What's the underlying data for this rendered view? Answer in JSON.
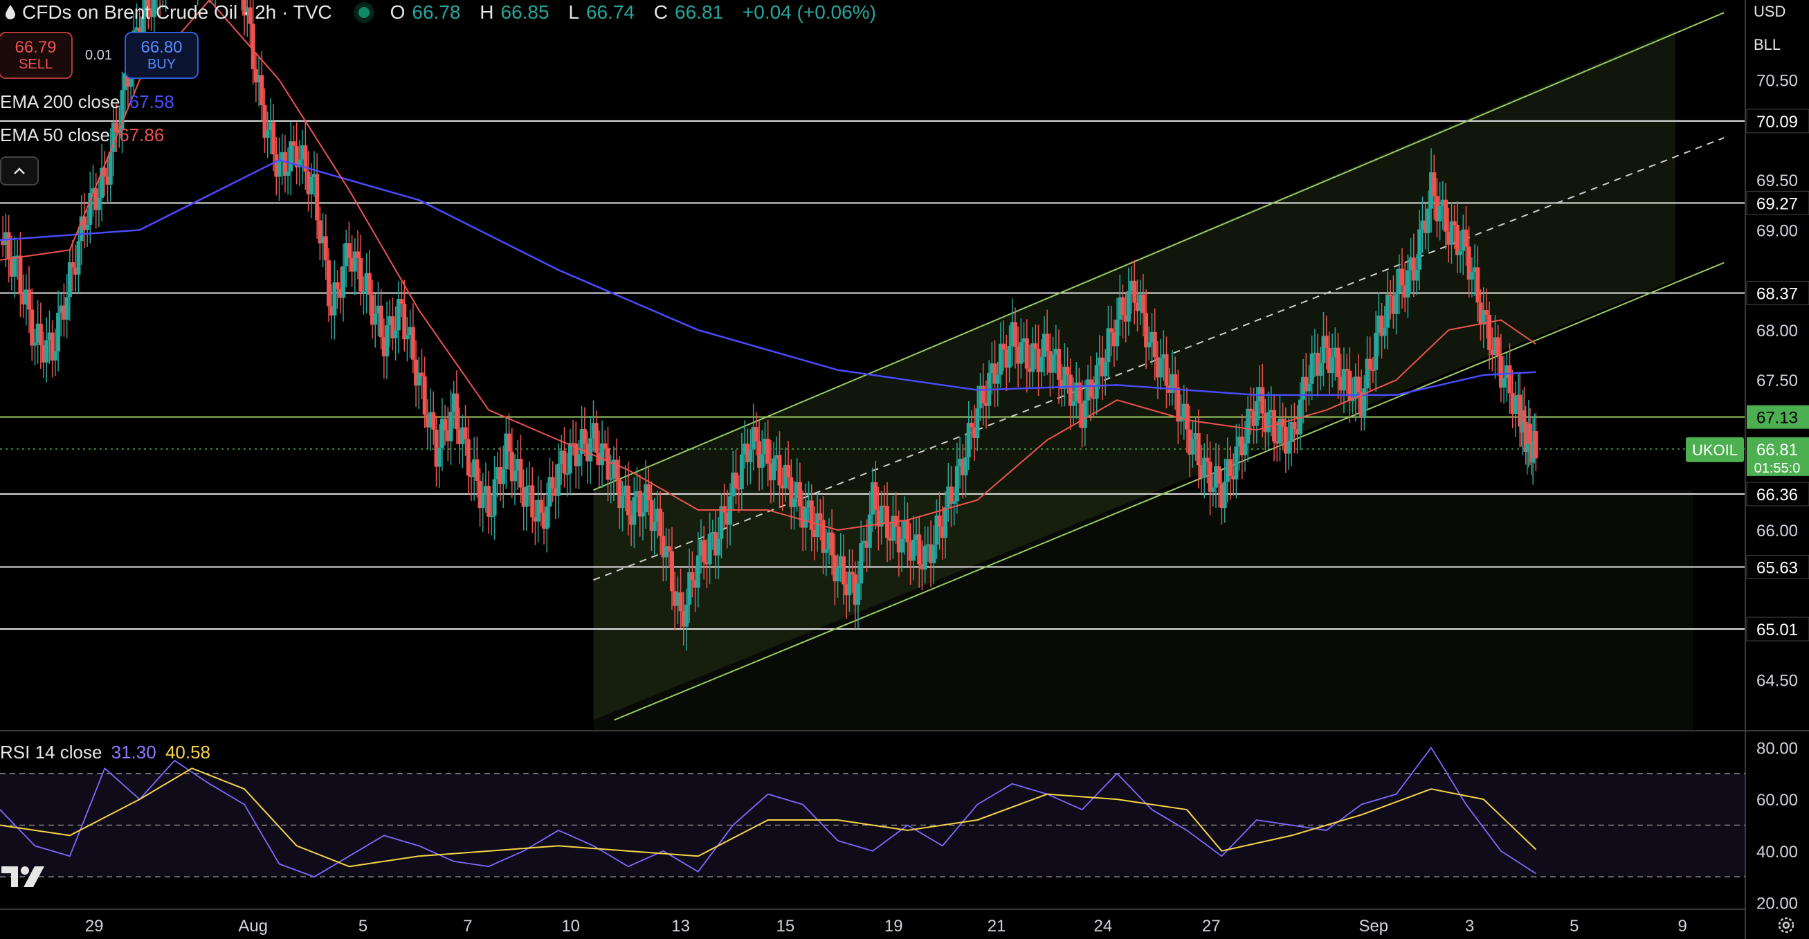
{
  "header": {
    "title": "CFDs on Brent Crude Oil · 2h · TVC",
    "ohlc": {
      "o_label": "O",
      "o": "66.78",
      "h_label": "H",
      "h": "66.85",
      "l_label": "L",
      "l": "66.74",
      "c_label": "C",
      "c": "66.81",
      "change": "+0.04 (+0.06%)"
    }
  },
  "trade": {
    "sell_price": "66.79",
    "sell_label": "SELL",
    "spread": "0.01",
    "buy_price": "66.80",
    "buy_label": "BUY"
  },
  "indicators": {
    "ema200": {
      "label": "EMA 200 close",
      "value": "67.58",
      "color": "#4b4bff"
    },
    "ema50": {
      "label": "EMA 50 close",
      "value": "67.86",
      "color": "#ef5350"
    },
    "rsi": {
      "label": "RSI 14 close",
      "value": "31.30",
      "ma_value": "40.58",
      "color": "#7e57c2",
      "ma_color": "#f5d547"
    }
  },
  "currency": {
    "top": "USD",
    "sub": "BLL"
  },
  "colors": {
    "up": "#26a69a",
    "down": "#ef5350",
    "channel": "#9ccc65",
    "accent": "#4caf50"
  },
  "chart_data": {
    "type": "line",
    "title": "CFDs on Brent Crude Oil · 2h · TVC",
    "symbol": "UKOIL",
    "last_price": "66.81",
    "countdown": "01:55:0",
    "price_ticks": [
      "70.50",
      "69.50",
      "69.00",
      "68.00",
      "67.50",
      "66.00",
      "64.50"
    ],
    "level_labels": [
      "70.09",
      "69.27",
      "68.37",
      "67.13",
      "66.36",
      "65.63",
      "65.01"
    ],
    "levels": [
      70.09,
      69.27,
      68.37,
      67.13,
      66.36,
      65.63,
      65.01
    ],
    "x_labels": [
      "29",
      "Aug",
      "5",
      "7",
      "10",
      "13",
      "15",
      "19",
      "21",
      "24",
      "27",
      "Sep",
      "3",
      "5",
      "9"
    ],
    "rsi_ticks": [
      "80.00",
      "60.00",
      "40.00",
      "20.00"
    ],
    "rsi_bands": [
      70,
      50,
      30
    ],
    "ylim": [
      64.0,
      71.3
    ],
    "rsi_ylim": [
      18,
      86
    ],
    "channel": {
      "x": [
        0.34,
        0.96
      ],
      "upper": [
        66.4,
        71.0
      ],
      "mid": [
        65.5,
        69.75
      ],
      "lower": [
        64.1,
        68.5
      ]
    },
    "close_path": [
      [
        0,
        68.9
      ],
      [
        0.01,
        68.6
      ],
      [
        0.02,
        67.9
      ],
      [
        0.03,
        67.8
      ],
      [
        0.04,
        68.5
      ],
      [
        0.05,
        69.2
      ],
      [
        0.06,
        69.5
      ],
      [
        0.07,
        70.3
      ],
      [
        0.08,
        71.1
      ],
      [
        0.09,
        71.4
      ],
      [
        0.1,
        71.8
      ],
      [
        0.12,
        71.5
      ],
      [
        0.13,
        72.0
      ],
      [
        0.14,
        71.3
      ],
      [
        0.15,
        70.2
      ],
      [
        0.16,
        69.6
      ],
      [
        0.17,
        69.8
      ],
      [
        0.18,
        69.4
      ],
      [
        0.19,
        68.2
      ],
      [
        0.2,
        68.8
      ],
      [
        0.21,
        68.4
      ],
      [
        0.22,
        67.9
      ],
      [
        0.23,
        68.2
      ],
      [
        0.24,
        67.5
      ],
      [
        0.25,
        66.8
      ],
      [
        0.26,
        67.2
      ],
      [
        0.27,
        66.6
      ],
      [
        0.28,
        66.2
      ],
      [
        0.29,
        66.8
      ],
      [
        0.3,
        66.4
      ],
      [
        0.31,
        66.1
      ],
      [
        0.32,
        66.6
      ],
      [
        0.33,
        66.8
      ],
      [
        0.34,
        66.9
      ],
      [
        0.35,
        66.6
      ],
      [
        0.36,
        66.2
      ],
      [
        0.37,
        66.3
      ],
      [
        0.38,
        65.9
      ],
      [
        0.39,
        65.1
      ],
      [
        0.4,
        65.7
      ],
      [
        0.41,
        65.9
      ],
      [
        0.42,
        66.4
      ],
      [
        0.43,
        66.9
      ],
      [
        0.44,
        66.7
      ],
      [
        0.45,
        66.5
      ],
      [
        0.46,
        66.2
      ],
      [
        0.47,
        66.0
      ],
      [
        0.48,
        65.6
      ],
      [
        0.49,
        65.4
      ],
      [
        0.5,
        66.3
      ],
      [
        0.51,
        66.0
      ],
      [
        0.52,
        65.9
      ],
      [
        0.53,
        65.7
      ],
      [
        0.54,
        66.1
      ],
      [
        0.55,
        66.6
      ],
      [
        0.56,
        67.2
      ],
      [
        0.57,
        67.6
      ],
      [
        0.58,
        67.9
      ],
      [
        0.59,
        67.7
      ],
      [
        0.6,
        67.8
      ],
      [
        0.61,
        67.5
      ],
      [
        0.62,
        67.2
      ],
      [
        0.63,
        67.6
      ],
      [
        0.64,
        68.1
      ],
      [
        0.65,
        68.4
      ],
      [
        0.66,
        67.8
      ],
      [
        0.67,
        67.5
      ],
      [
        0.68,
        67.0
      ],
      [
        0.69,
        66.6
      ],
      [
        0.7,
        66.4
      ],
      [
        0.71,
        66.8
      ],
      [
        0.72,
        67.3
      ],
      [
        0.73,
        67.0
      ],
      [
        0.74,
        66.9
      ],
      [
        0.75,
        67.6
      ],
      [
        0.76,
        67.8
      ],
      [
        0.77,
        67.5
      ],
      [
        0.78,
        67.3
      ],
      [
        0.79,
        68.0
      ],
      [
        0.8,
        68.4
      ],
      [
        0.81,
        68.6
      ],
      [
        0.82,
        69.4
      ],
      [
        0.83,
        69.0
      ],
      [
        0.84,
        68.8
      ],
      [
        0.85,
        68.1
      ],
      [
        0.86,
        67.6
      ],
      [
        0.87,
        67.2
      ],
      [
        0.875,
        66.9
      ],
      [
        0.88,
        66.81
      ]
    ],
    "ema200": [
      [
        0,
        68.9
      ],
      [
        0.08,
        69.0
      ],
      [
        0.16,
        69.7
      ],
      [
        0.24,
        69.3
      ],
      [
        0.32,
        68.6
      ],
      [
        0.4,
        68.0
      ],
      [
        0.48,
        67.6
      ],
      [
        0.56,
        67.4
      ],
      [
        0.64,
        67.45
      ],
      [
        0.72,
        67.35
      ],
      [
        0.8,
        67.35
      ],
      [
        0.85,
        67.55
      ],
      [
        0.88,
        67.58
      ]
    ],
    "ema50": [
      [
        0,
        68.7
      ],
      [
        0.04,
        68.8
      ],
      [
        0.08,
        70.5
      ],
      [
        0.12,
        71.3
      ],
      [
        0.16,
        70.5
      ],
      [
        0.2,
        69.4
      ],
      [
        0.24,
        68.2
      ],
      [
        0.28,
        67.2
      ],
      [
        0.32,
        66.9
      ],
      [
        0.36,
        66.6
      ],
      [
        0.4,
        66.2
      ],
      [
        0.44,
        66.2
      ],
      [
        0.48,
        66.0
      ],
      [
        0.52,
        66.1
      ],
      [
        0.56,
        66.3
      ],
      [
        0.6,
        66.9
      ],
      [
        0.64,
        67.3
      ],
      [
        0.68,
        67.1
      ],
      [
        0.72,
        67.0
      ],
      [
        0.76,
        67.2
      ],
      [
        0.8,
        67.5
      ],
      [
        0.83,
        68.0
      ],
      [
        0.86,
        68.1
      ],
      [
        0.88,
        67.86
      ]
    ],
    "rsi_path": [
      [
        0,
        56
      ],
      [
        0.02,
        42
      ],
      [
        0.04,
        38
      ],
      [
        0.06,
        72
      ],
      [
        0.08,
        60
      ],
      [
        0.1,
        75
      ],
      [
        0.12,
        66
      ],
      [
        0.14,
        58
      ],
      [
        0.16,
        35
      ],
      [
        0.18,
        30
      ],
      [
        0.2,
        38
      ],
      [
        0.22,
        46
      ],
      [
        0.24,
        42
      ],
      [
        0.26,
        36
      ],
      [
        0.28,
        34
      ],
      [
        0.3,
        40
      ],
      [
        0.32,
        48
      ],
      [
        0.34,
        42
      ],
      [
        0.36,
        34
      ],
      [
        0.38,
        40
      ],
      [
        0.4,
        32
      ],
      [
        0.42,
        50
      ],
      [
        0.44,
        62
      ],
      [
        0.46,
        58
      ],
      [
        0.48,
        44
      ],
      [
        0.5,
        40
      ],
      [
        0.52,
        50
      ],
      [
        0.54,
        42
      ],
      [
        0.56,
        58
      ],
      [
        0.58,
        66
      ],
      [
        0.6,
        62
      ],
      [
        0.62,
        56
      ],
      [
        0.64,
        70
      ],
      [
        0.66,
        56
      ],
      [
        0.68,
        48
      ],
      [
        0.7,
        38
      ],
      [
        0.72,
        52
      ],
      [
        0.74,
        50
      ],
      [
        0.76,
        48
      ],
      [
        0.78,
        58
      ],
      [
        0.8,
        62
      ],
      [
        0.82,
        80
      ],
      [
        0.84,
        58
      ],
      [
        0.86,
        40
      ],
      [
        0.88,
        31.3
      ]
    ],
    "rsi_ma": [
      [
        0,
        50
      ],
      [
        0.04,
        46
      ],
      [
        0.08,
        60
      ],
      [
        0.11,
        72
      ],
      [
        0.14,
        64
      ],
      [
        0.17,
        42
      ],
      [
        0.2,
        34
      ],
      [
        0.24,
        38
      ],
      [
        0.28,
        40
      ],
      [
        0.32,
        42
      ],
      [
        0.36,
        40
      ],
      [
        0.4,
        38
      ],
      [
        0.44,
        52
      ],
      [
        0.48,
        52
      ],
      [
        0.52,
        48
      ],
      [
        0.56,
        52
      ],
      [
        0.6,
        62
      ],
      [
        0.64,
        60
      ],
      [
        0.68,
        56
      ],
      [
        0.7,
        40
      ],
      [
        0.74,
        46
      ],
      [
        0.78,
        54
      ],
      [
        0.82,
        64
      ],
      [
        0.85,
        60
      ],
      [
        0.88,
        40.58
      ]
    ]
  }
}
